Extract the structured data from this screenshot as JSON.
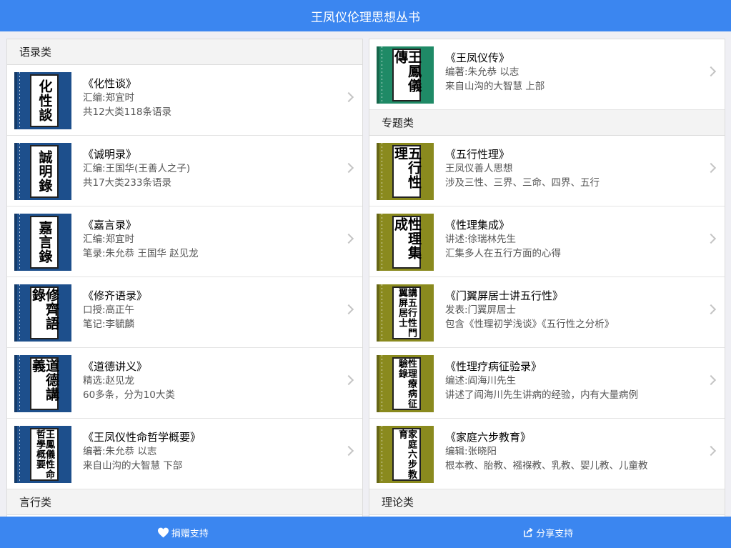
{
  "header": {
    "title": "王凤仪伦理思想丛书"
  },
  "left": {
    "section1": "语录类",
    "books": [
      {
        "cover": "化性談",
        "cover_color": "#1d4f8c",
        "title": "《化性谈》",
        "line1": "汇编:郑宜时",
        "line2": "共12大类118条语录"
      },
      {
        "cover": "誠明錄",
        "cover_color": "#1d4f8c",
        "title": "《诚明录》",
        "line1": "汇编:王国华(王善人之子)",
        "line2": "共17大类233条语录"
      },
      {
        "cover": "嘉言錄",
        "cover_color": "#1d4f8c",
        "title": "《嘉言录》",
        "line1": "汇编:郑宜时",
        "line2": "笔录:朱允恭 王国华 赵见龙"
      },
      {
        "cover": "修齊語錄",
        "cover_color": "#1d4f8c",
        "title": "《修齐语录》",
        "line1": "口授:高正午",
        "line2": "笔记:李毓麟"
      },
      {
        "cover": "道德講義",
        "cover_color": "#1d4f8c",
        "title": "《道德讲义》",
        "line1": "精选:赵见龙",
        "line2": "60多条，分为10大类"
      },
      {
        "cover": "王鳳儀性命哲學概要",
        "cover_color": "#1d4f8c",
        "title": "《王凤仪性命哲学概要》",
        "line1": "编著:朱允恭 以志",
        "line2": "来自山沟的大智慧 下部"
      }
    ],
    "section2": "言行类"
  },
  "right": {
    "top_book": {
      "cover": "王鳳儀傳",
      "cover_color": "#1f8a66",
      "title": "《王凤仪传》",
      "line1": "编著:朱允恭 以志",
      "line2": "来自山沟的大智慧 上部"
    },
    "section1": "专题类",
    "books": [
      {
        "cover": "五行性理",
        "cover_color": "#8a8a1e",
        "title": "《五行性理》",
        "line1": "王凤仪善人思想",
        "line2": "涉及三性、三界、三命、四界、五行"
      },
      {
        "cover": "性理集成",
        "cover_color": "#8a8a1e",
        "title": "《性理集成》",
        "line1": "讲述:徐瑞林先生",
        "line2": "汇集多人在五行方面的心得"
      },
      {
        "cover": "講五行性門翼屏居士",
        "cover_color": "#8a8a1e",
        "title": "《门翼屏居士讲五行性》",
        "line1": "发表:门翼屏居士",
        "line2": "包含《性理初学浅谈》《五行性之分析》"
      },
      {
        "cover": "性理療病征驗錄",
        "cover_color": "#8a8a1e",
        "title": "《性理疗病征验录》",
        "line1": "编述:阎海川先生",
        "line2": "讲述了阎海川先生讲病的经验，内有大量病例"
      },
      {
        "cover": "家庭六步教育",
        "cover_color": "#8a8a1e",
        "title": "《家庭六步教育》",
        "line1": "编辑:张晓阳",
        "line2": "根本教、胎教、襁褓教、乳教、婴儿教、儿童教"
      }
    ],
    "section2": "理论类"
  },
  "footer": {
    "donate_label": "捐赠支持",
    "share_label": "分享支持",
    "donate_icon": "heart-icon",
    "share_icon": "share-icon"
  },
  "colors": {
    "accent": "#3b86f0"
  }
}
